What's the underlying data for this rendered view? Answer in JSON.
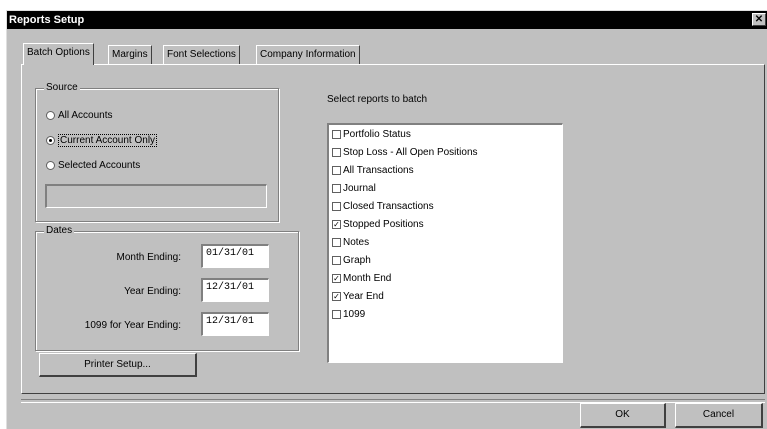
{
  "window": {
    "title": "Reports Setup",
    "close_glyph": "✕"
  },
  "tabs": [
    {
      "label": "Batch Options",
      "active": true
    },
    {
      "label": "Margins",
      "active": false
    },
    {
      "label": "Font Selections",
      "active": false
    },
    {
      "label": "Company Information",
      "active": false
    }
  ],
  "source": {
    "legend": "Source",
    "options": [
      {
        "label": "All Accounts",
        "selected": false
      },
      {
        "label": "Current Account Only",
        "selected": true
      },
      {
        "label": "Selected Accounts",
        "selected": false
      }
    ],
    "selected_accounts_value": ""
  },
  "dates": {
    "legend": "Dates",
    "month_label": "Month Ending:",
    "month_value": "01/31/01",
    "year_label": "Year Ending:",
    "year_value": "12/31/01",
    "tax_label": "1099 for Year Ending:",
    "tax_value": "12/31/01"
  },
  "printer_setup_label": "Printer Setup...",
  "reports": {
    "label": "Select reports to batch",
    "items": [
      {
        "label": "Portfolio Status",
        "checked": false
      },
      {
        "label": "Stop Loss - All Open Positions",
        "checked": false
      },
      {
        "label": "All Transactions",
        "checked": false
      },
      {
        "label": "Journal",
        "checked": false
      },
      {
        "label": "Closed Transactions",
        "checked": false
      },
      {
        "label": "Stopped Positions",
        "checked": true
      },
      {
        "label": "Notes",
        "checked": false
      },
      {
        "label": "Graph",
        "checked": false
      },
      {
        "label": "Month End",
        "checked": true
      },
      {
        "label": "Year End",
        "checked": true
      },
      {
        "label": "1099",
        "checked": false
      }
    ]
  },
  "buttons": {
    "ok": "OK",
    "cancel": "Cancel"
  }
}
